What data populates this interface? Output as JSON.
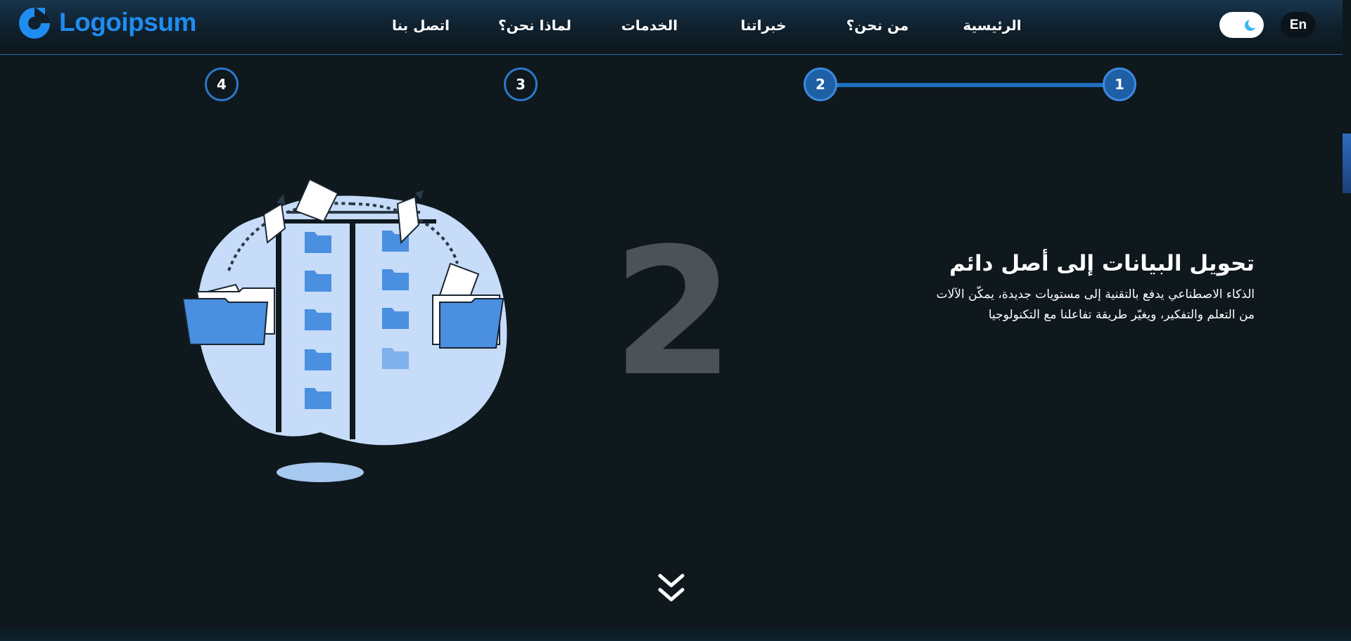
{
  "header": {
    "logo_text": "Logoipsum",
    "brand_color": "#1f8cf0",
    "nav": [
      {
        "label": "الرئيسية"
      },
      {
        "label": "من نحن؟"
      },
      {
        "label": "خبراتنا"
      },
      {
        "label": "الخدمات"
      },
      {
        "label": "لماذا نحن؟"
      },
      {
        "label": "اتصل بنا"
      }
    ],
    "theme_toggle_icon": "moon-icon",
    "language_label": "En"
  },
  "stepper": {
    "steps": [
      {
        "label": "1"
      },
      {
        "label": "2"
      },
      {
        "label": "3"
      },
      {
        "label": "4"
      }
    ],
    "current_step": 2,
    "accent_color": "#2a78c8"
  },
  "hero": {
    "big_number": "2",
    "title": "تحويل البيانات إلى أصل دائم",
    "description_line1": "الذكاء الاصطناعي يدفع بالتقنية إلى مستويات جديدة، يمكّن الآلات",
    "description_line2": "من التعلم والتفكير، ويغيّر طريقة تفاعلنا مع التكنولوجيا",
    "illustration_icon": "file-transfer-illustration",
    "scroll_icon": "double-chevron-down-icon"
  }
}
